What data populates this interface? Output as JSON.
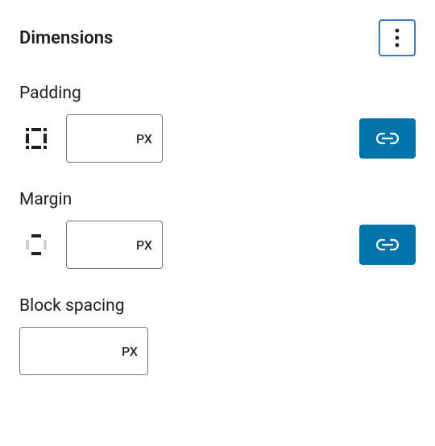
{
  "panel": {
    "title": "Dimensions"
  },
  "fields": {
    "padding": {
      "label": "Padding",
      "value": "",
      "unit": "PX"
    },
    "margin": {
      "label": "Margin",
      "value": "",
      "unit": "PX"
    },
    "block_spacing": {
      "label": "Block spacing",
      "value": "",
      "unit": "PX"
    }
  }
}
